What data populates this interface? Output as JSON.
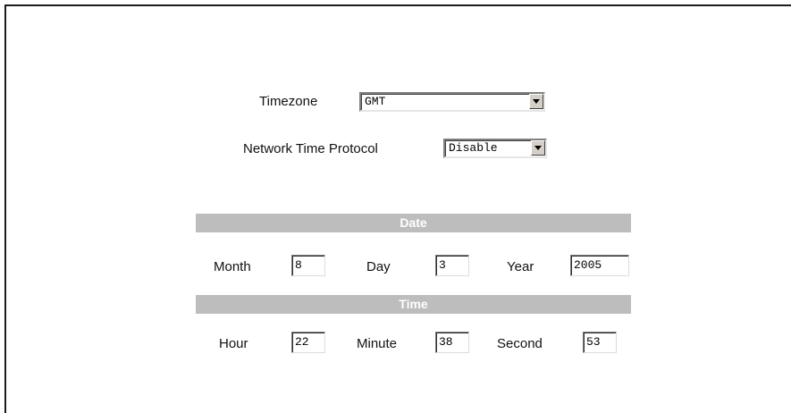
{
  "settings": {
    "timezone_label": "Timezone",
    "timezone_value": "GMT",
    "ntp_label": "Network Time Protocol",
    "ntp_value": "Disable"
  },
  "date_section": {
    "title": "Date",
    "month_label": "Month",
    "month_value": "8",
    "day_label": "Day",
    "day_value": "3",
    "year_label": "Year",
    "year_value": "2005"
  },
  "time_section": {
    "title": "Time",
    "hour_label": "Hour",
    "hour_value": "22",
    "minute_label": "Minute",
    "minute_value": "38",
    "second_label": "Second",
    "second_value": "53"
  }
}
